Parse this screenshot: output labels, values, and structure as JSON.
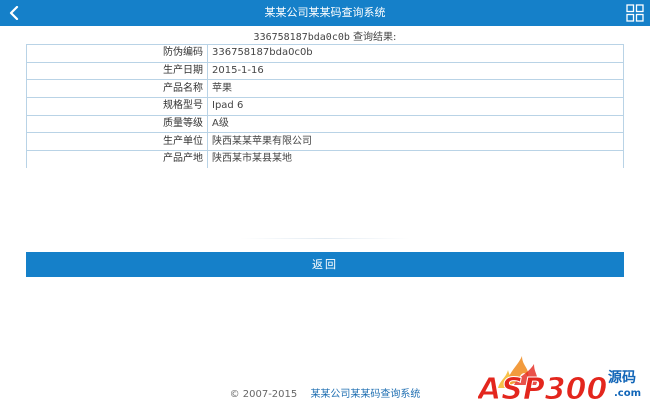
{
  "header": {
    "title": "某某公司某某码查询系统",
    "back_icon": "chevron-left-icon",
    "menu_icon": "grid-icon"
  },
  "query": {
    "code": "336758187bda0c0b",
    "suffix": " 查询结果:"
  },
  "details": [
    {
      "label": "防伪编码",
      "value": "336758187bda0c0b"
    },
    {
      "label": "生产日期",
      "value": "2015-1-16"
    },
    {
      "label": "产品名称",
      "value": "苹果"
    },
    {
      "label": "规格型号",
      "value": "Ipad 6"
    },
    {
      "label": "质量等级",
      "value": "A级"
    },
    {
      "label": "生产单位",
      "value": "陕西某某苹果有限公司"
    },
    {
      "label": "产品产地",
      "value": "陕西某市某县某地"
    }
  ],
  "return_button": {
    "label": "返回"
  },
  "footer": {
    "copyright": "© 2007-2015",
    "link": "某某公司某某码查询系统"
  },
  "watermark": {
    "text_main": "ASP300",
    "text_side": "源码",
    "domain": ".com"
  },
  "colors": {
    "primary": "#1580c9",
    "border": "#b9d3e6",
    "watermark_red": "#e3261d",
    "watermark_blue": "#1266b8"
  }
}
